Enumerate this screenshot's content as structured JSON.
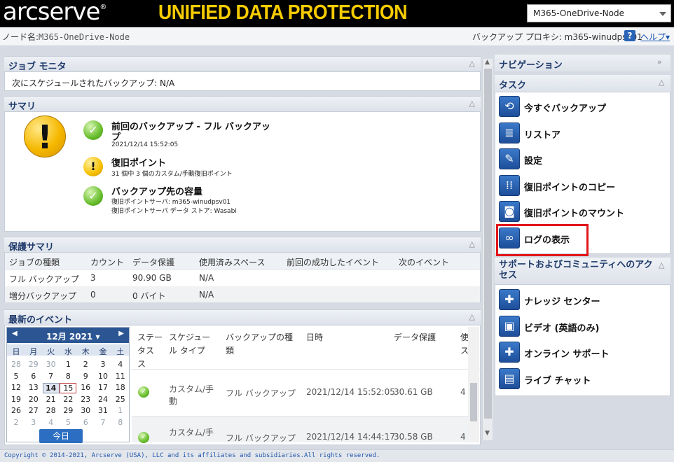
{
  "header": {
    "brand": "arcserve",
    "brand_reg": "®",
    "product": "UNIFIED DATA PROTECTION",
    "node_select": "M365-OneDrive-Node"
  },
  "infobar": {
    "node_label": "ノード名:",
    "node_value": "M365-OneDrive-Node",
    "proxy": "バックアップ プロキシ: m365-winudpsv01",
    "help_icon": "?",
    "help": "ヘルプ"
  },
  "job_monitor": {
    "title": "ジョブ モニタ",
    "text": "次にスケジュールされたバックアップ: N/A"
  },
  "summary": {
    "title": "サマリ",
    "items": [
      {
        "title": "前回のバックアップ - フル バックアッ",
        "title2": "プ",
        "sub1": "2021/12/14 15:52:05",
        "sub2": ""
      },
      {
        "title": "復旧ポイント",
        "title2": "",
        "sub1": "31 個中 3 個のカスタム/手動復旧ポイント",
        "sub2": ""
      },
      {
        "title": "バックアップ先の容量",
        "title2": "",
        "sub1": "復旧ポイントサーバ: m365-winudpsv01",
        "sub2": "復旧ポイントサーバ データ ストア: Wasabi"
      }
    ]
  },
  "protection_summary": {
    "title": "保護サマリ",
    "columns": [
      "ジョブの種類",
      "カウント",
      "データ保護",
      "使用済みスペース",
      "前回の成功したイベント",
      "次のイベント"
    ],
    "rows": [
      [
        "フル バックアップ",
        "3",
        "90.90 GB",
        "N/A",
        "",
        ""
      ],
      [
        "増分バックアップ",
        "0",
        "0 バイト",
        "N/A",
        "",
        ""
      ]
    ]
  },
  "recent_events": {
    "title": "最新のイベント",
    "calendar": {
      "month": "12月 2021",
      "dow": [
        "日",
        "月",
        "火",
        "水",
        "木",
        "金",
        "土"
      ],
      "weeks": [
        [
          "28",
          "29",
          "30",
          "1",
          "2",
          "3",
          "4"
        ],
        [
          "5",
          "6",
          "7",
          "8",
          "9",
          "10",
          "11"
        ],
        [
          "12",
          "13",
          "14",
          "15",
          "16",
          "17",
          "18"
        ],
        [
          "19",
          "20",
          "21",
          "22",
          "23",
          "24",
          "25"
        ],
        [
          "26",
          "27",
          "28",
          "29",
          "30",
          "31",
          "1"
        ],
        [
          "2",
          "3",
          "4",
          "5",
          "6",
          "7",
          "8"
        ]
      ],
      "today_button": "今日"
    },
    "columns": {
      "status_1": "ステー",
      "status_2": "タス",
      "status_3": "ス",
      "schedule_1": "スケジュー",
      "schedule_2": "ル タイプ",
      "backup_type_1": "バックアップの種",
      "backup_type_2": "類",
      "date": "日時",
      "data": "データ保護",
      "used_1": "使用",
      "used_2": "ス"
    },
    "rows": [
      {
        "schedule_1": "カスタム/手",
        "schedule_2": "動",
        "type": "フル バックアップ",
        "date": "2021/12/14 15:52:05",
        "data": "30.61 GB",
        "used": "4"
      },
      {
        "schedule_1": "カスタム/手",
        "schedule_2": "",
        "type": "フル バックアップ",
        "date": "2021/12/14 14:44:17",
        "data": "30.58 GB",
        "used": "4"
      }
    ]
  },
  "navigation": {
    "title": "ナビゲーション",
    "tasks_title": "タスク",
    "tasks": [
      {
        "label": "今すぐバックアップ",
        "icon": "backup-now-icon",
        "glyph": "⟲"
      },
      {
        "label": "リストア",
        "icon": "restore-icon",
        "glyph": "≣"
      },
      {
        "label": "設定",
        "icon": "settings-wrench-icon",
        "glyph": "✎"
      },
      {
        "label": "復旧ポイントのコピー",
        "icon": "copy-recovery-point-icon",
        "glyph": "⁞⁞"
      },
      {
        "label": "復旧ポイントのマウント",
        "icon": "mount-recovery-point-icon",
        "glyph": "◙"
      },
      {
        "label": "ログの表示",
        "icon": "view-logs-icon",
        "glyph": "∞"
      }
    ],
    "support_title_1": "サポートおよびコミュニティへのアク",
    "support_title_2": "セス",
    "support": [
      {
        "label": "ナレッジ センター",
        "icon": "knowledge-center-icon",
        "glyph": "✚"
      },
      {
        "label": "ビデオ (英語のみ)",
        "icon": "video-icon",
        "glyph": "▣"
      },
      {
        "label": "オンライン サポート",
        "icon": "online-support-icon",
        "glyph": "✚"
      },
      {
        "label": "ライブ チャット",
        "icon": "live-chat-icon",
        "glyph": "▤"
      }
    ]
  },
  "footer": {
    "copyright": "Copyright © 2014-2021, Arcserve (USA), LLC and its affiliates and subsidiaries.All rights reserved."
  },
  "colors": {
    "accent": "#2c5693",
    "brand_yellow": "#f7cc00",
    "highlight": "#e1161b"
  }
}
